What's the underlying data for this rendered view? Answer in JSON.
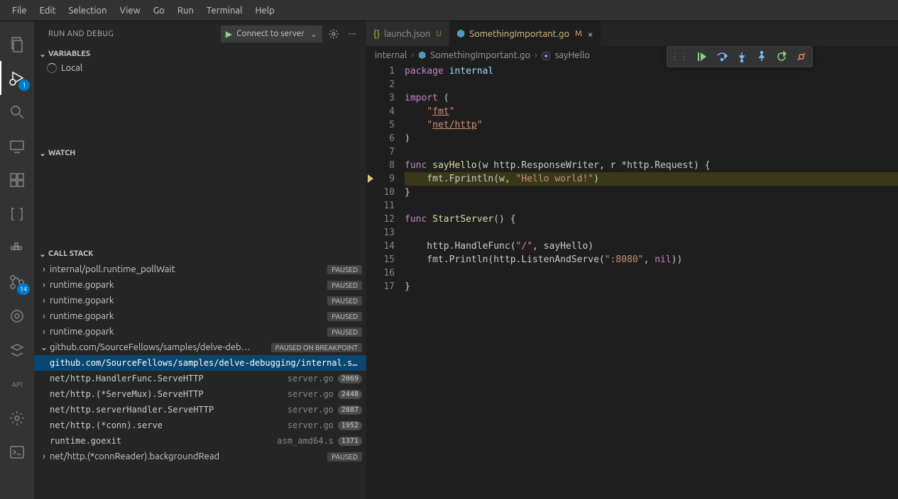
{
  "menubar": [
    "File",
    "Edit",
    "Selection",
    "View",
    "Go",
    "Run",
    "Terminal",
    "Help"
  ],
  "activity": {
    "run_badge": "1",
    "scm_badge": "14"
  },
  "sidebar": {
    "title": "RUN AND DEBUG",
    "run_config": "Connect to server",
    "sections": {
      "variables": "VARIABLES",
      "local": "Local",
      "watch": "WATCH",
      "callstack": "CALL STACK"
    },
    "paused": "PAUSED",
    "paused_bp": "PAUSED ON BREAKPOINT",
    "threads": [
      {
        "name": "internal/poll.runtime_pollWait",
        "state": "PAUSED",
        "open": false
      },
      {
        "name": "runtime.gopark",
        "state": "PAUSED",
        "open": false
      },
      {
        "name": "runtime.gopark",
        "state": "PAUSED",
        "open": false
      },
      {
        "name": "runtime.gopark",
        "state": "PAUSED",
        "open": false
      },
      {
        "name": "runtime.gopark",
        "state": "PAUSED",
        "open": false
      },
      {
        "name": "github.com/SourceFellows/samples/delve-deb…",
        "state": "PAUSED ON BREAKPOINT",
        "open": true,
        "frames": [
          {
            "fn": "github.com/SourceFellows/samples/delve-debugging/internal.sayHello",
            "file": "",
            "line": "",
            "selected": true
          },
          {
            "fn": "net/http.HandlerFunc.ServeHTTP",
            "file": "server.go",
            "line": "2069"
          },
          {
            "fn": "net/http.(*ServeMux).ServeHTTP",
            "file": "server.go",
            "line": "2448"
          },
          {
            "fn": "net/http.serverHandler.ServeHTTP",
            "file": "server.go",
            "line": "2887"
          },
          {
            "fn": "net/http.(*conn).serve",
            "file": "server.go",
            "line": "1952"
          },
          {
            "fn": "runtime.goexit",
            "file": "asm_amd64.s",
            "line": "1371"
          }
        ]
      },
      {
        "name": "net/http.(*connReader).backgroundRead",
        "state": "PAUSED",
        "open": false
      }
    ]
  },
  "tabs": [
    {
      "label": "launch.json",
      "status": "U",
      "active": false,
      "kind": "json"
    },
    {
      "label": "SomethingImportant.go",
      "status": "M",
      "active": true,
      "kind": "go"
    }
  ],
  "breadcrumb": {
    "parts": [
      "internal",
      "SomethingImportant.go",
      "sayHello"
    ]
  },
  "code": {
    "breakpoint_line": 9,
    "lines": [
      "package internal",
      "",
      "import (",
      "    \"fmt\"",
      "    \"net/http\"",
      ")",
      "",
      "func sayHello(w http.ResponseWriter, r *http.Request) {",
      "    fmt.Fprintln(w, \"Hello world!\")",
      "}",
      "",
      "func StartServer() {",
      "",
      "    http.HandleFunc(\"/\", sayHello)",
      "    fmt.Println(http.ListenAndServe(\":8080\", nil))",
      "",
      "}"
    ]
  }
}
